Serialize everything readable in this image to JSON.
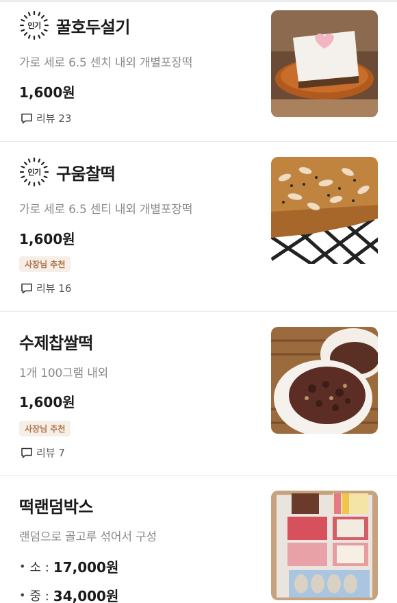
{
  "items": [
    {
      "popular_label": "인기",
      "title": "꿀호두설기",
      "description": "가로 세로 6.5 센치 내외 개별포장떡",
      "price": "1,600원",
      "review_label": "리뷰 23"
    },
    {
      "popular_label": "인기",
      "title": "구움찰떡",
      "description": "가로 세로 6.5 센티 내외 개별포장떡",
      "price": "1,600원",
      "badge": "사장님 추천",
      "review_label": "리뷰 16"
    },
    {
      "title": "수제찹쌀떡",
      "description": "1개 100그램 내외",
      "price": "1,600원",
      "badge": "사장님 추천",
      "review_label": "리뷰 7"
    },
    {
      "title": "떡랜덤박스",
      "description": "랜덤으로 골고루 섞어서 구성",
      "options": [
        {
          "bullet": "•",
          "size": "소 :",
          "price": "17,000원"
        },
        {
          "bullet": "•",
          "size": "중 :",
          "price": "34,000원"
        }
      ]
    }
  ],
  "colors": {
    "badge_bg": "#f6efe8",
    "badge_text": "#b0744a",
    "divider": "#e9e9e9"
  },
  "icons": {
    "popular": "sunburst-badge-icon",
    "review": "speech-bubble-icon"
  }
}
